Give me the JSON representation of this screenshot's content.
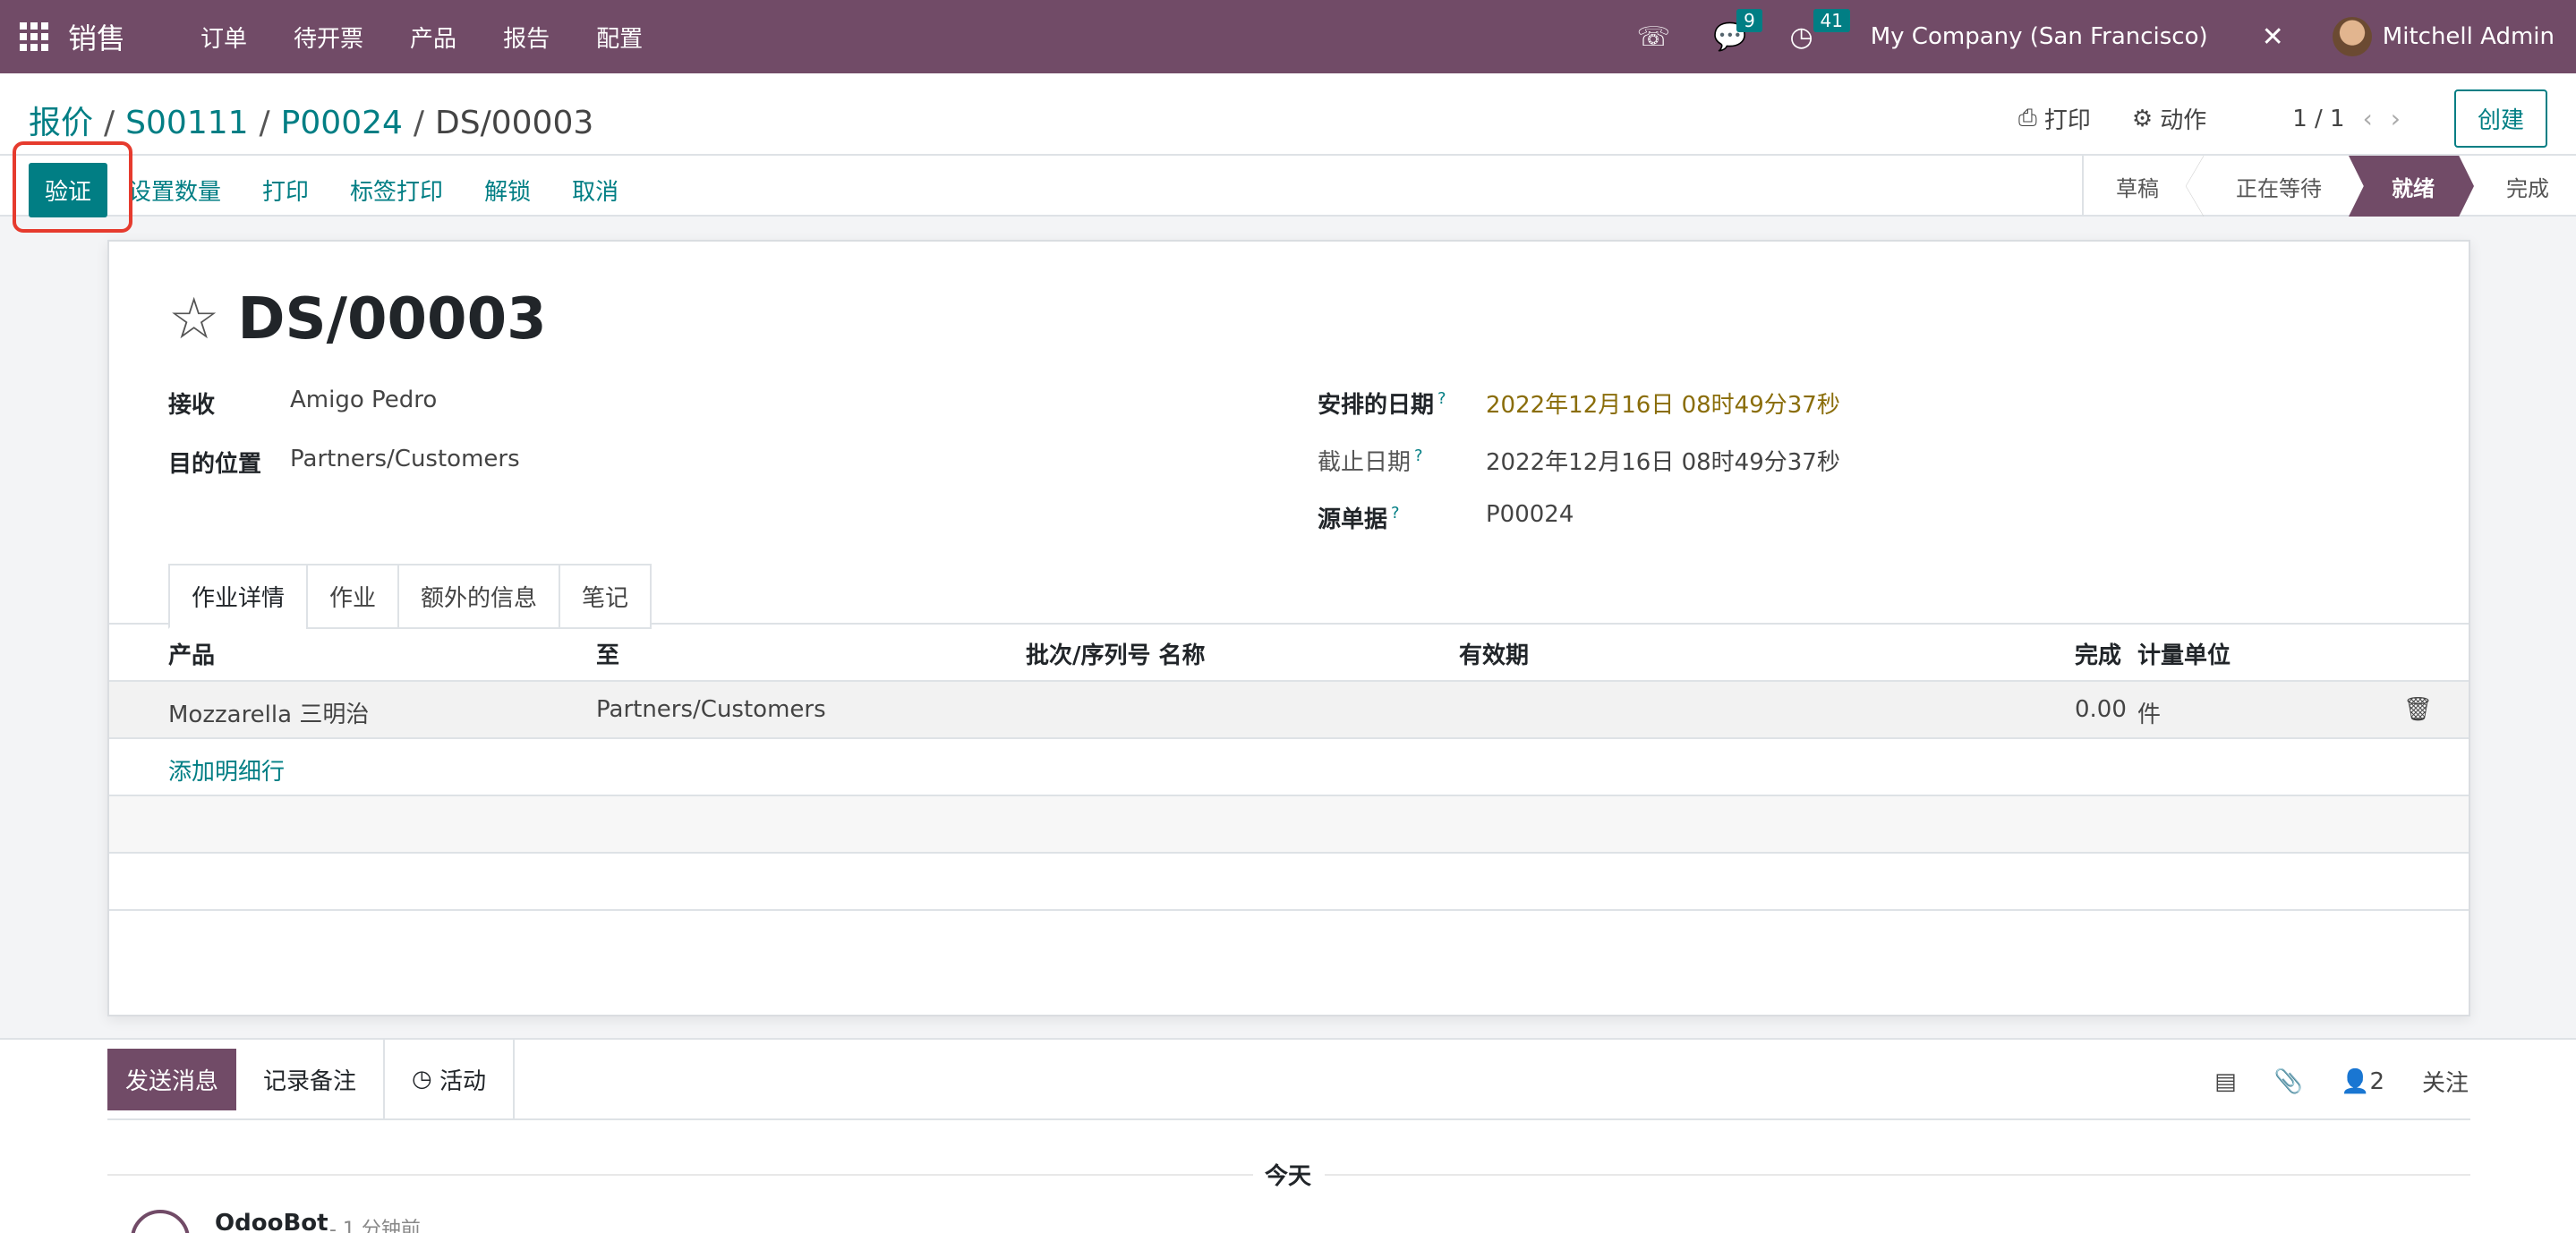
{
  "navbar": {
    "app_name": "销售",
    "menu": [
      "订单",
      "待开票",
      "产品",
      "报告",
      "配置"
    ],
    "messages_count": "9",
    "activities_count": "41",
    "company": "My Company (San Francisco)",
    "user": "Mitchell Admin",
    "accent_color": "#714b67"
  },
  "breadcrumb": {
    "items": [
      "报价",
      "S00111",
      "P00024"
    ],
    "current": "DS/00003",
    "sep": "/"
  },
  "control": {
    "print_label": "打印",
    "action_label": "动作",
    "pager": "1 / 1",
    "create_label": "创建",
    "validate_label": "验证",
    "actions": [
      "设置数量",
      "打印",
      "标签打印",
      "解锁",
      "取消"
    ],
    "stages": [
      "草稿",
      "正在等待",
      "就绪",
      "完成"
    ],
    "active_stage": "就绪"
  },
  "form": {
    "title": "DS/00003",
    "receive_label": "接收",
    "receive_value": "Amigo Pedro",
    "dest_label": "目的位置",
    "dest_value": "Partners/Customers",
    "scheduled_label": "安排的日期",
    "scheduled_value": "2022年12月16日 08时49分37秒",
    "deadline_label": "截止日期",
    "deadline_value": "2022年12月16日 08时49分37秒",
    "source_label": "源单据",
    "source_value": "P00024",
    "help_mark": "?"
  },
  "tabs": [
    "作业详情",
    "作业",
    "额外的信息",
    "笔记"
  ],
  "table": {
    "headers": {
      "product": "产品",
      "to": "至",
      "lot": "批次/序列号 名称",
      "expiry": "有效期",
      "done": "完成",
      "uom": "计量单位"
    },
    "rows": [
      {
        "product": "Mozzarella 三明治",
        "to": "Partners/Customers",
        "done": "0.00",
        "uom": "件"
      }
    ],
    "add_line": "添加明细行"
  },
  "chatter": {
    "send_label": "发送消息",
    "note_label": "记录备注",
    "activity_label": "活动",
    "followers_count": "2",
    "follow_label": "关注",
    "today_label": "今天",
    "author": "OdooBot",
    "time": "- 1 分钟前"
  }
}
